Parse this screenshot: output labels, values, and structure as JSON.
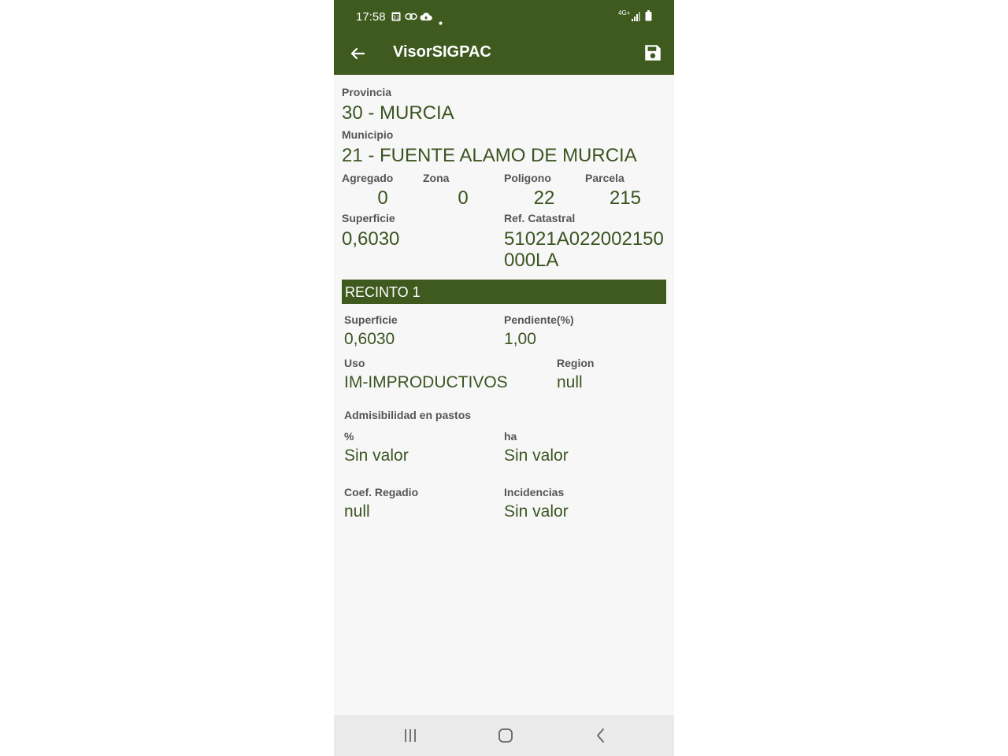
{
  "status_bar": {
    "time": "17:58",
    "network_label": "4G+",
    "icons": [
      "calendar-icon",
      "link-icon",
      "cloud-icon",
      "notification-dot-icon",
      "signal-icon",
      "battery-icon"
    ]
  },
  "app_bar": {
    "title": "VisorSIGPAC",
    "back_icon": "arrow-left-icon",
    "save_icon": "save-icon"
  },
  "parcel": {
    "provincia_label": "Provincia",
    "provincia_value": "30 - MURCIA",
    "municipio_label": "Municipio",
    "municipio_value": "21 - FUENTE ALAMO DE MURCIA",
    "agregado_label": "Agregado",
    "agregado_value": "0",
    "zona_label": "Zona",
    "zona_value": "0",
    "poligono_label": "Poligono",
    "poligono_value": "22",
    "parcela_label": "Parcela",
    "parcela_value": "215",
    "superficie_label": "Superficie",
    "superficie_value": "0,6030",
    "ref_catastral_label": "Ref. Catastral",
    "ref_catastral_line1": "51021A022002150",
    "ref_catastral_line2": "000LA"
  },
  "recinto": {
    "header": "RECINTO 1",
    "superficie_label": "Superficie",
    "superficie_value": "0,6030",
    "pendiente_label": "Pendiente(%)",
    "pendiente_value": "1,00",
    "uso_label": "Uso",
    "uso_value": "IM-IMPRODUCTIVOS",
    "region_label": "Region",
    "region_value": "null",
    "admisibilidad_label": "Admisibilidad en pastos",
    "pct_label": "%",
    "pct_value": "Sin valor",
    "ha_label": "ha",
    "ha_value": "Sin valor",
    "coef_regadio_label": "Coef. Regadio",
    "coef_regadio_value": "null",
    "incidencias_label": "Incidencias",
    "incidencias_value": "Sin valor"
  },
  "nav_bar": {
    "icons": [
      "recent-apps-icon",
      "home-icon",
      "back-nav-icon"
    ]
  },
  "colors": {
    "primary": "#3f5a1f",
    "value_text": "#3b5420",
    "background": "#f7f7f7"
  }
}
